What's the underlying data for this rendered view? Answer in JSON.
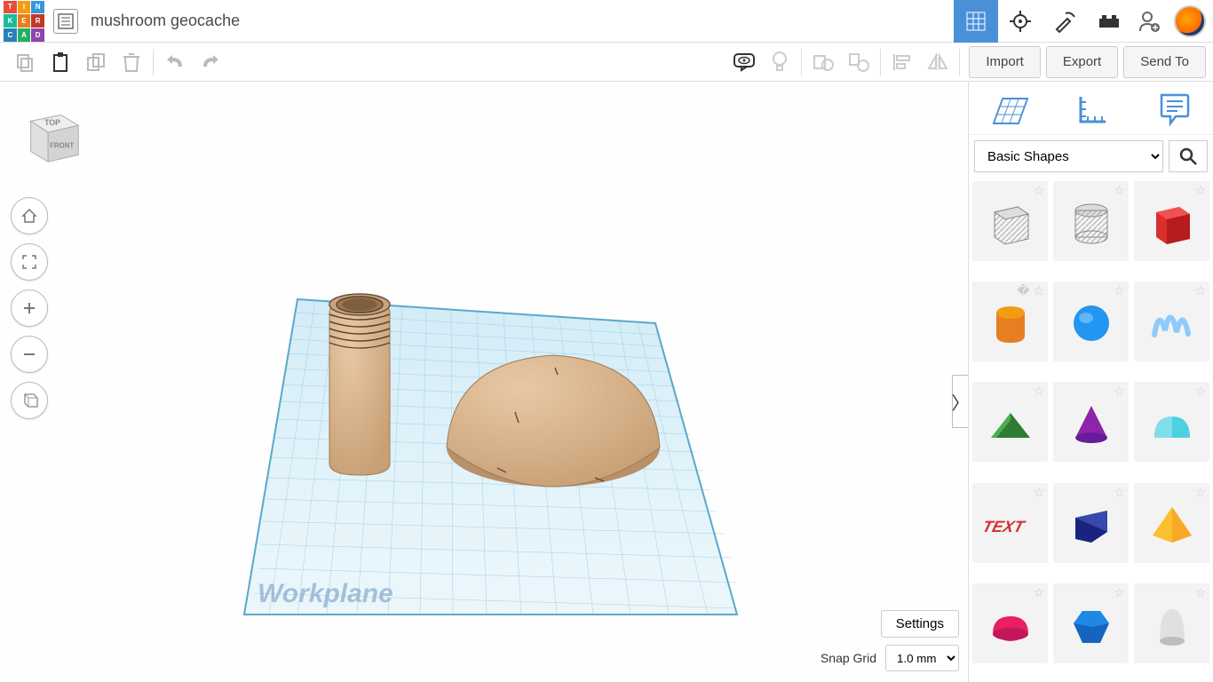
{
  "header": {
    "project_title": "mushroom geocache",
    "apps": [
      "3d-designs",
      "circuits",
      "codeblocks",
      "lego",
      "account"
    ]
  },
  "toolbar": {
    "import_label": "Import",
    "export_label": "Export",
    "sendto_label": "Send To"
  },
  "viewcube": {
    "top": "TOP",
    "front": "FRONT"
  },
  "canvas": {
    "workplane_label": "Workplane",
    "settings_label": "Settings",
    "snapgrid_label": "Snap Grid",
    "snapgrid_value": "1.0 mm"
  },
  "sidebar": {
    "category": "Basic Shapes",
    "shapes": [
      {
        "name": "box-hole"
      },
      {
        "name": "cylinder-hole"
      },
      {
        "name": "box"
      },
      {
        "name": "cylinder"
      },
      {
        "name": "sphere"
      },
      {
        "name": "scribble"
      },
      {
        "name": "roof"
      },
      {
        "name": "cone"
      },
      {
        "name": "round-roof"
      },
      {
        "name": "text"
      },
      {
        "name": "wedge"
      },
      {
        "name": "pyramid"
      },
      {
        "name": "half-sphere"
      },
      {
        "name": "polygon"
      },
      {
        "name": "paraboloid"
      }
    ]
  }
}
